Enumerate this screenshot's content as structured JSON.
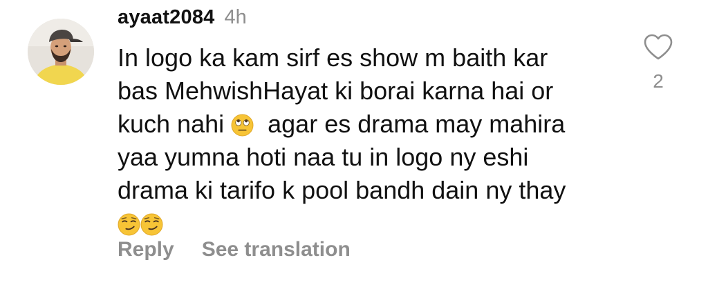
{
  "comment": {
    "username": "ayaat2084",
    "timestamp": "4h",
    "text_lines": [
      "In logo ka kam sirf es show m baith kar",
      "bas MehwishHayat ki borai karna hai or",
      "kuch nahi",
      "agar es drama may mahira",
      "yaa yumna hoti naa tu in logo ny eshi",
      "drama ki tarifo k pool bandh dain ny thay"
    ],
    "emojis": [
      "face-with-rolling-eyes",
      "smirking-face",
      "smirking-face"
    ],
    "like_count": "2",
    "actions": {
      "reply_label": "Reply",
      "see_translation_label": "See translation"
    }
  },
  "colors": {
    "text_primary": "#111111",
    "text_secondary": "#8e8e8e",
    "emoji_yellow": "#f7c436",
    "background": "#ffffff"
  }
}
